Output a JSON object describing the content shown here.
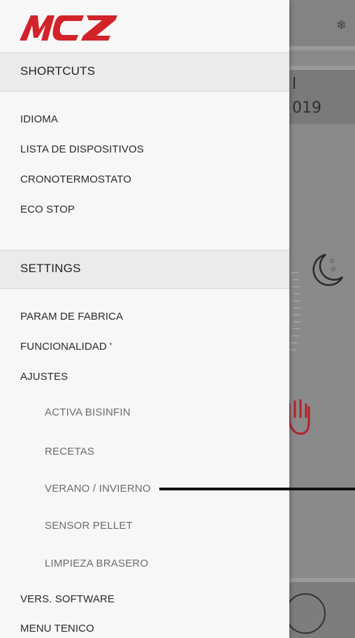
{
  "brand": {
    "logo_text": "MCZ",
    "logo_color": "#d2232a"
  },
  "background": {
    "date_fragment": "019",
    "line_fragment": "l",
    "snow_icon": "snowflake-icon"
  },
  "drawer": {
    "shortcuts": {
      "title": "SHORTCUTS",
      "items": [
        "IDIOMA",
        "LISTA DE DISPOSITIVOS",
        "CRONOTERMOSTATO",
        "ECO STOP"
      ]
    },
    "settings": {
      "title": "SETTINGS",
      "items": [
        "PARAM DE FABRICA",
        "FUNCIONALIDAD '",
        "AJUSTES"
      ],
      "ajustes_subitems": [
        "ACTIVA BISINFIN",
        "RECETAS",
        "VERANO / INVIERNO",
        "SENSOR PELLET",
        "LIMPIEZA BRASERO"
      ],
      "bottom_items": [
        "VERS. SOFTWARE",
        "MENU TENICO"
      ]
    }
  }
}
